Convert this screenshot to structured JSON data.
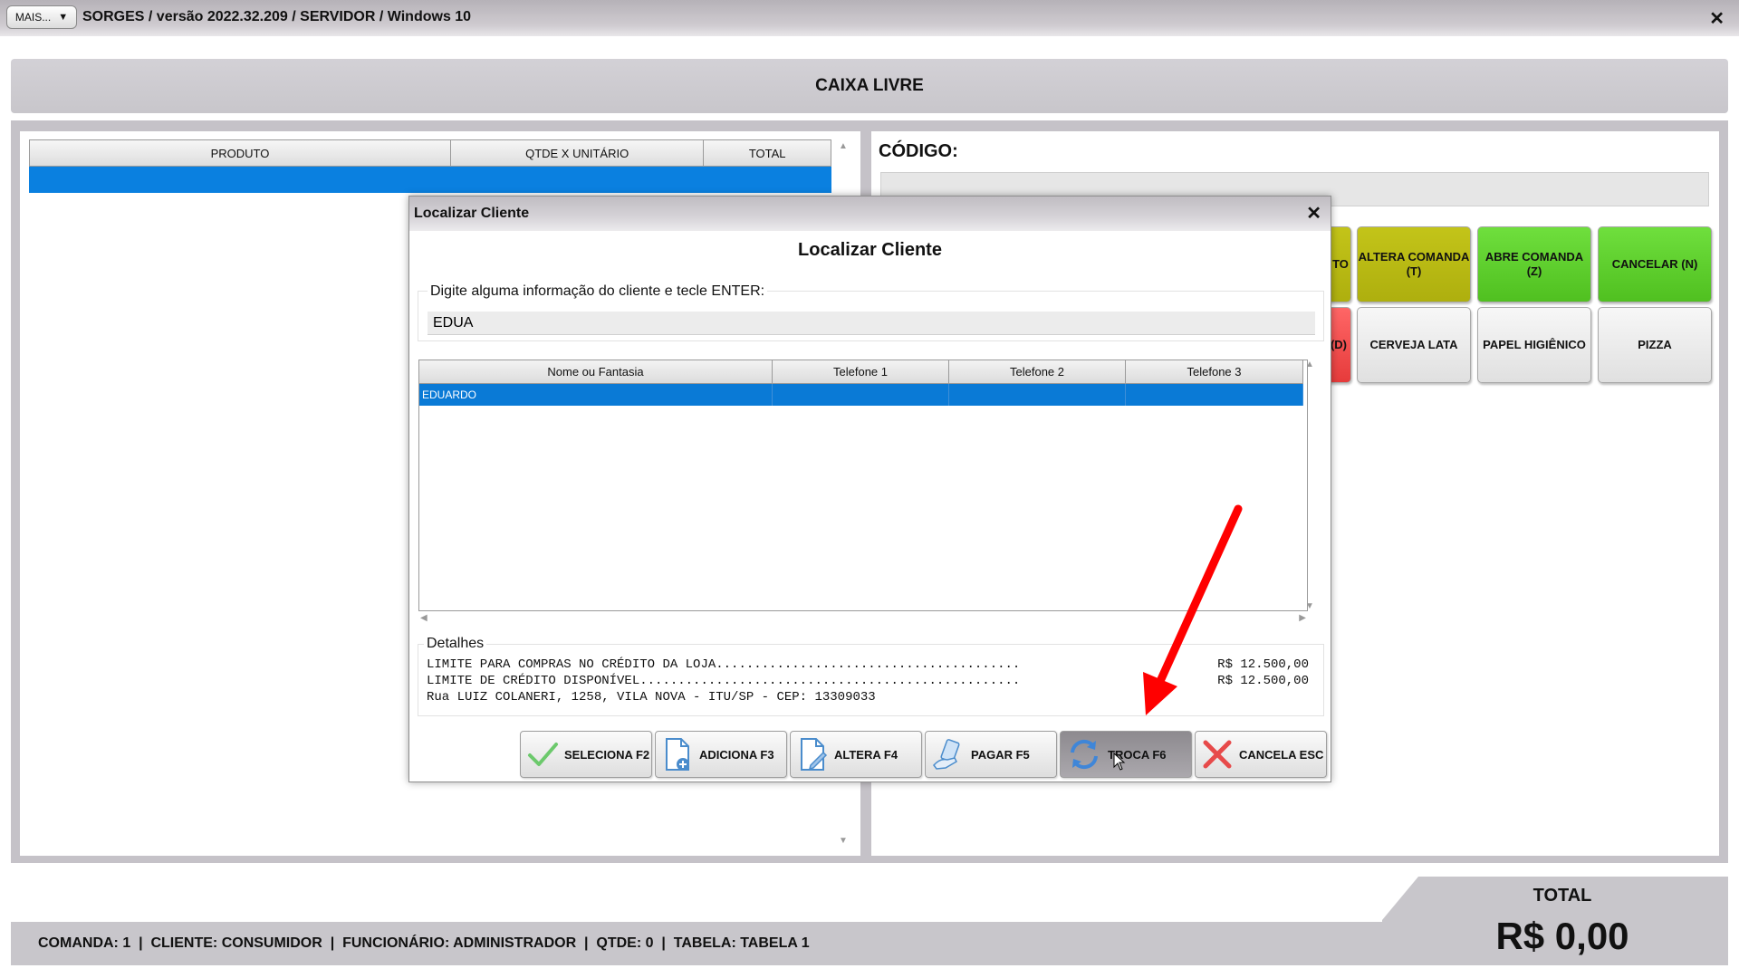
{
  "window": {
    "mais_label": "MAIS...",
    "title": "SORGES / versão 2022.32.209 / SERVIDOR / Windows 10",
    "close": "✕"
  },
  "status": {
    "text": "CAIXA LIVRE"
  },
  "product_table": {
    "columns": [
      "PRODUTO",
      "QTDE X UNITÁRIO",
      "TOTAL"
    ]
  },
  "codigo": {
    "label": "CÓDIGO:"
  },
  "shortcuts": [
    {
      "label": "TO",
      "color": "olive"
    },
    {
      "label": "ALTERA COMANDA (T)",
      "color": "olive"
    },
    {
      "label": "ABRE COMANDA (Z)",
      "color": "green"
    },
    {
      "label": "CANCELAR (N)",
      "color": "green"
    },
    {
      "label": "(D)",
      "color": "red"
    },
    {
      "label": "CERVEJA LATA",
      "color": "gray"
    },
    {
      "label": "PAPEL HIGIÊNICO",
      "color": "gray"
    },
    {
      "label": "PIZZA",
      "color": "gray"
    }
  ],
  "footer": {
    "info": "COMANDA: 1  |  CLIENTE: CONSUMIDOR  |  FUNCIONÁRIO: ADMINISTRADOR  |  QTDE: 0  |  TABELA: TABELA 1",
    "total_label": "TOTAL",
    "total_value": "R$ 0,00"
  },
  "dialog": {
    "title": "Localizar Cliente",
    "heading": "Localizar Cliente",
    "close": "✕",
    "search_label": "Digite alguma informação do cliente e tecle ENTER:",
    "search_value": "EDUA",
    "grid_columns": [
      "Nome ou Fantasia",
      "Telefone 1",
      "Telefone 2",
      "Telefone 3"
    ],
    "grid_rows": [
      {
        "name": "EDUARDO",
        "tel1": "",
        "tel2": "",
        "tel3": ""
      }
    ],
    "details_label": "Detalhes",
    "details": [
      {
        "text": "LIMITE PARA COMPRAS NO CRÉDITO DA LOJA........................................",
        "value": "R$ 12.500,00"
      },
      {
        "text": "LIMITE DE CRÉDITO DISPONÍVEL..................................................",
        "value": "R$ 12.500,00"
      },
      {
        "text": "Rua LUIZ COLANERI, 1258, VILA NOVA - ITU/SP - CEP: 13309033",
        "value": ""
      }
    ],
    "buttons": [
      {
        "label": "SELECIONA F2",
        "icon": "check-icon"
      },
      {
        "label": "ADICIONA F3",
        "icon": "add-document-icon"
      },
      {
        "label": "ALTERA F4",
        "icon": "edit-document-icon"
      },
      {
        "label": "PAGAR F5",
        "icon": "payment-icon"
      },
      {
        "label": "TROCA F6",
        "icon": "refresh-icon"
      },
      {
        "label": "CANCELA ESC",
        "icon": "x-icon"
      }
    ]
  },
  "colors": {
    "selection": "#0a7ad6",
    "olive": "#b8b914",
    "green": "#5ad02c",
    "red": "#f04a4a",
    "annotation": "#ff0000"
  }
}
